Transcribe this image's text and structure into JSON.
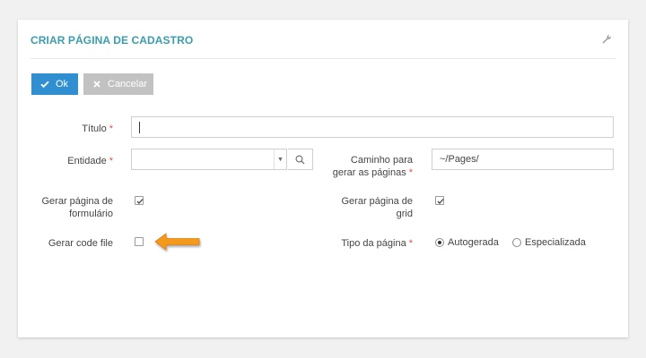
{
  "panel": {
    "title": "CRIAR PÁGINA DE CADASTRO",
    "settings_icon": "wrench-icon"
  },
  "toolbar": {
    "ok_label": "Ok",
    "ok_icon": "check-icon",
    "cancel_label": "Cancelar",
    "cancel_icon": "close-icon"
  },
  "form": {
    "titulo": {
      "label": "Título",
      "value": ""
    },
    "entidade": {
      "label": "Entidade",
      "value": "",
      "dropdown_icon": "chevron-down-icon",
      "search_icon": "search-icon"
    },
    "caminho": {
      "label_line1": "Caminho para",
      "label_line2": "gerar as páginas",
      "value": "~/Pages/"
    },
    "gerar_formulario": {
      "label_line1": "Gerar página de",
      "label_line2": "formulário",
      "checked": true
    },
    "gerar_grid": {
      "label_line1": "Gerar página de",
      "label_line2": "grid",
      "checked": true
    },
    "gerar_code_file": {
      "label": "Gerar code file",
      "checked": false
    },
    "tipo_pagina": {
      "label": "Tipo da página",
      "options": [
        "Autogerada",
        "Especializada"
      ],
      "selected": "Autogerada"
    },
    "required_marker": "*"
  },
  "colors": {
    "title": "#3a9dae",
    "ok_button": "#2f8fd0",
    "cancel_button": "#c2c2c2",
    "required": "#e05050",
    "arrow": "#f39a1e"
  }
}
